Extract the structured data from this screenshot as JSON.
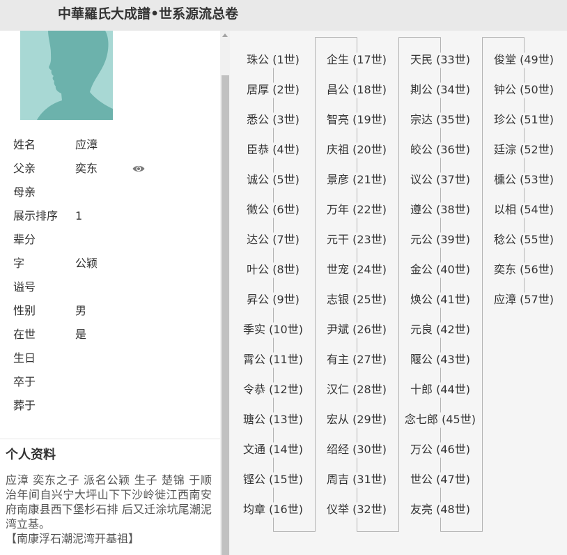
{
  "header": {
    "title": "中華羅氏大成譜•世系源流总卷"
  },
  "colors": {
    "header_bg": "#e9e9e9",
    "panel_bg": "#f5f5f5",
    "connector_line": "#b3b3b3",
    "avatar_bg": "#a8d8d4",
    "avatar_figure": "#6cb2ac"
  },
  "icons": {
    "father_view": "eye-icon",
    "scroll_up": "triangle-up-icon"
  },
  "profile": {
    "fields": [
      {
        "label": "姓名",
        "value": "应漳"
      },
      {
        "label": "父亲",
        "value": "奕东"
      },
      {
        "label": "母亲",
        "value": ""
      },
      {
        "label": "展示排序",
        "value": "1"
      },
      {
        "label": "辈分",
        "value": ""
      },
      {
        "label": "字",
        "value": "公颖"
      },
      {
        "label": "谥号",
        "value": ""
      },
      {
        "label": "性别",
        "value": "男"
      },
      {
        "label": "在世",
        "value": "是"
      },
      {
        "label": "生日",
        "value": ""
      },
      {
        "label": "卒于",
        "value": ""
      },
      {
        "label": "葬于",
        "value": ""
      }
    ]
  },
  "bio": {
    "heading": "个人资料",
    "text": "应漳 奕东之子 派名公颖 生子 楚锦 于顺治年间自兴宁大坪山下下沙岭徙江西南安府南康县西下堡杉石排 后又迁涂坑尾潮泥湾立基。",
    "note": "【南康浮石潮泥湾开基祖】"
  },
  "lineage": {
    "items": [
      "珠公 (1世)",
      "居厚 (2世)",
      "悉公 (3世)",
      "臣恭 (4世)",
      "诚公 (5世)",
      "徵公 (6世)",
      "达公 (7世)",
      "叶公 (8世)",
      "昇公 (9世)",
      "季实 (10世)",
      "霄公 (11世)",
      "令恭 (12世)",
      "瑭公 (13世)",
      "文通 (14世)",
      "铿公 (15世)",
      "均章 (16世)",
      "企生 (17世)",
      "昌公 (18世)",
      "智亮 (19世)",
      "庆祖 (20世)",
      "景彦 (21世)",
      "万年 (22世)",
      "元干 (23世)",
      "世宠 (24世)",
      "志银 (25世)",
      "尹斌 (26世)",
      "有主 (27世)",
      "汉仁 (28世)",
      "宏从 (29世)",
      "绍经 (30世)",
      "周吉 (31世)",
      "仪举 (32世)",
      "天民 (33世)",
      "剘公 (34世)",
      "宗达 (35世)",
      "皎公 (36世)",
      "议公 (37世)",
      "遵公 (38世)",
      "元公 (39世)",
      "金公 (40世)",
      "焕公 (41世)",
      "元良 (42世)",
      "隁公 (43世)",
      "十郎 (44世)",
      "念七郎 (45世)",
      "万公 (46世)",
      "世公 (47世)",
      "友亮 (48世)",
      "俊堂 (49世)",
      "钟公 (50世)",
      "珍公 (51世)",
      "廷淙 (52世)",
      "櫄公 (53世)",
      "以相 (54世)",
      "稔公 (55世)",
      "奕东 (56世)",
      "应漳 (57世)"
    ]
  }
}
